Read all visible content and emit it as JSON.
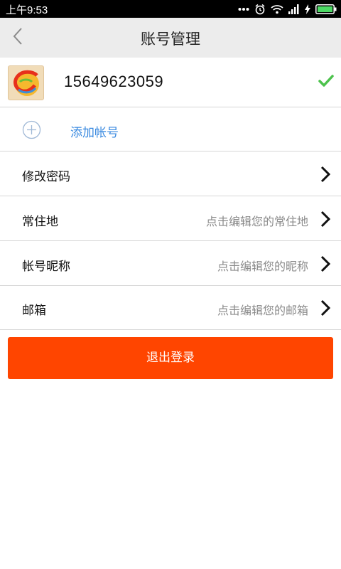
{
  "status_bar": {
    "time": "上午9:53"
  },
  "header": {
    "title": "账号管理"
  },
  "account": {
    "number": "15649623059"
  },
  "add_account": {
    "label": "添加帐号"
  },
  "menu": {
    "change_password": {
      "label": "修改密码"
    },
    "residence": {
      "label": "常住地",
      "hint": "点击编辑您的常住地"
    },
    "nickname": {
      "label": "帐号昵称",
      "hint": "点击编辑您的昵称"
    },
    "email": {
      "label": "邮箱",
      "hint": "点击编辑您的邮箱"
    }
  },
  "logout": {
    "label": "退出登录"
  },
  "colors": {
    "accent": "#ff4500",
    "link": "#3a8ae0",
    "check": "#4cc24c"
  }
}
